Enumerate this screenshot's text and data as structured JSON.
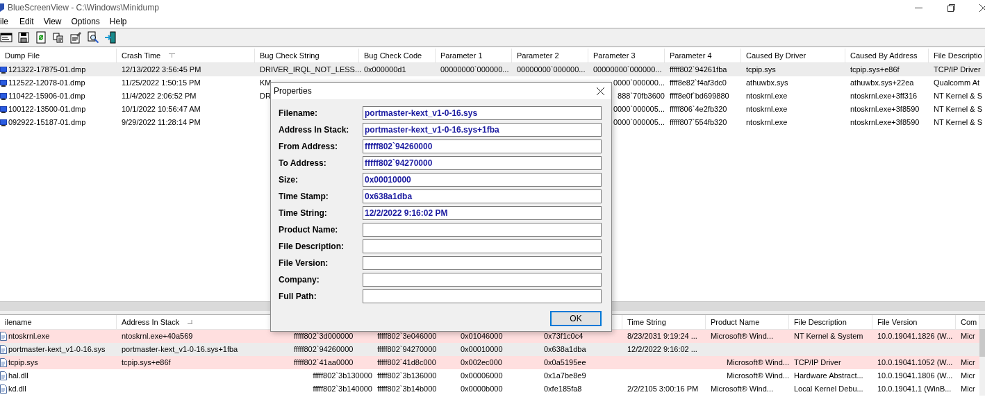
{
  "window": {
    "title": "BlueScreenView  -  C:\\Windows\\Minidump"
  },
  "menu": [
    "ile",
    "Edit",
    "View",
    "Options",
    "Help"
  ],
  "toolbar": [
    {
      "kind": "window"
    },
    {
      "kind": "save"
    },
    {
      "kind": "refresh"
    },
    {
      "kind": "copy"
    },
    {
      "kind": "properties"
    },
    {
      "kind": "find"
    },
    {
      "kind": "exit"
    }
  ],
  "dump_table": {
    "columns": [
      {
        "label": "Dump File"
      },
      {
        "label": "Crash Time",
        "sorted": true,
        "ascending": false
      },
      {
        "label": "Bug Check String"
      },
      {
        "label": "Bug Check Code"
      },
      {
        "label": "Parameter 1"
      },
      {
        "label": "Parameter 2"
      },
      {
        "label": "Parameter 3"
      },
      {
        "label": "Parameter 4"
      },
      {
        "label": "Caused By Driver"
      },
      {
        "label": "Caused By Address"
      },
      {
        "label": "File Descriptio"
      }
    ],
    "rows": [
      {
        "selected": true,
        "cells": [
          "121322-17875-01.dmp",
          "12/13/2022 3:56:45 PM",
          "DRIVER_IRQL_NOT_LESS...",
          "0x000000d1",
          "00000000`000000...",
          "00000000`000000...",
          "00000000`000000...",
          "fffff802`94261fba",
          "tcpip.sys",
          "tcpip.sys+e86f",
          "TCP/IP Driver"
        ]
      },
      {
        "selected": false,
        "cells": [
          "112522-12078-01.dmp",
          "11/25/2022 1:50:15 PM",
          "KM",
          null,
          null,
          null,
          "0000`000000...",
          "ffff8e82`f4af3dc0",
          "athuwbx.sys",
          "athuwbx.sys+22ea",
          "Qualcomm At"
        ]
      },
      {
        "selected": false,
        "cells": [
          "110422-15906-01.dmp",
          "11/4/2022 2:06:52 PM",
          "DR",
          null,
          null,
          null,
          "888`70fb3600",
          "ffff8e0f`bd699880",
          "ntoskrnl.exe",
          "ntoskrnl.exe+3ff316",
          "NT Kernel & S"
        ]
      },
      {
        "selected": false,
        "cells": [
          "100122-13500-01.dmp",
          "10/1/2022 10:56:47 AM",
          null,
          null,
          null,
          null,
          "0000`000005...",
          "fffff806`4e2fb320",
          "ntoskrnl.exe",
          "ntoskrnl.exe+3f8590",
          "NT Kernel & S"
        ]
      },
      {
        "selected": false,
        "cells": [
          "092922-15187-01.dmp",
          "9/29/2022 11:28:14 PM",
          null,
          null,
          null,
          null,
          "0000`000005...",
          "fffff807`554fb320",
          "ntoskrnl.exe",
          "ntoskrnl.exe+3f8590",
          "NT Kernel & S"
        ]
      }
    ]
  },
  "driver_table": {
    "columns": [
      {
        "label": "ilename"
      },
      {
        "label": "Address In Stack",
        "sorted": true,
        "ascending": true
      },
      null,
      null,
      null,
      null,
      {
        "label": "Time String"
      },
      {
        "label": "Product Name"
      },
      {
        "label": "File Description"
      },
      {
        "label": "File Version"
      },
      {
        "label": "Com"
      }
    ],
    "rows": [
      {
        "selected": false,
        "highlighted": true,
        "cells": [
          "ntoskrnl.exe",
          "ntoskrnl.exe+40a569",
          "fffff802`3d000000",
          "fffff802`3e046000",
          "0x01046000",
          "0x73f1c0c4",
          "8/23/2031 9:19:24 ...",
          "Microsoft® Wind...",
          "NT Kernel & System",
          "10.0.19041.1826 (W...",
          "Micr"
        ]
      },
      {
        "selected": true,
        "highlighted": false,
        "cells": [
          "portmaster-kext_v1-0-16.sys",
          "portmaster-kext_v1-0-16.sys+1fba",
          "fffff802`94260000",
          "fffff802`94270000",
          "0x00010000",
          "0x638a1dba",
          "12/2/2022 9:16:02 ...",
          null,
          null,
          null,
          null
        ]
      },
      {
        "selected": false,
        "highlighted": true,
        "cells": [
          "tcpip.sys",
          "tcpip.sys+e86f",
          "fffff802`41aa0000",
          "fffff802`41d8c000",
          "0x002ec000",
          "0x0a5195ee",
          null,
          "Microsoft® Wind...",
          "TCP/IP Driver",
          "10.0.19041.1052 (W...",
          "Micr"
        ]
      },
      {
        "selected": false,
        "highlighted": false,
        "cells": [
          "hal.dll",
          null,
          "fffff802`3b130000",
          "fffff802`3b136000",
          "0x00006000",
          "0x1a7be8e9",
          null,
          "Microsoft® Wind...",
          "Hardware Abstract...",
          "10.0.19041.1806 (W...",
          "Micr"
        ]
      },
      {
        "selected": false,
        "highlighted": false,
        "cells": [
          "kd.dll",
          null,
          "fffff802`3b140000",
          "fffff802`3b14b000",
          "0x0000b000",
          "0xfe185fa8",
          "2/2/2105 3:00:16 PM",
          "Microsoft® Wind...",
          "Local Kernel Debu...",
          "10.0.19041.1 (WinB...",
          "Micr"
        ]
      }
    ]
  },
  "properties_dialog": {
    "title": "Properties",
    "fields": [
      {
        "label": "Filename:",
        "value": "portmaster-kext_v1-0-16.sys"
      },
      {
        "label": "Address In Stack:",
        "value": "portmaster-kext_v1-0-16.sys+1fba"
      },
      {
        "label": "From Address:",
        "value": "fffff802`94260000"
      },
      {
        "label": "To Address:",
        "value": "fffff802`94270000"
      },
      {
        "label": "Size:",
        "value": "0x00010000"
      },
      {
        "label": "Time Stamp:",
        "value": "0x638a1dba"
      },
      {
        "label": "Time String:",
        "value": "12/2/2022 9:16:02 PM"
      },
      {
        "label": "Product Name:"
      },
      {
        "label": "File Description:"
      },
      {
        "label": "File Version:"
      },
      {
        "label": "Company:"
      },
      {
        "label": "Full Path:"
      }
    ],
    "button": "OK"
  }
}
